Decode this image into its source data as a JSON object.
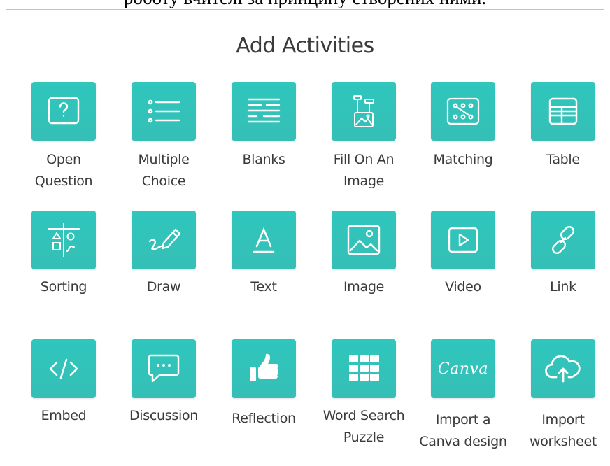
{
  "banner_text": "роботу вчителі за принципу створених ними.",
  "title": "Add Activities",
  "activities": [
    {
      "label": "Open Question",
      "icon": "question-icon"
    },
    {
      "label": "Multiple Choice",
      "icon": "list-icon"
    },
    {
      "label": "Blanks",
      "icon": "blanks-icon"
    },
    {
      "label": "Fill On An Image",
      "icon": "fill-image-icon"
    },
    {
      "label": "Matching",
      "icon": "matching-icon"
    },
    {
      "label": "Table",
      "icon": "table-icon"
    },
    {
      "label": "Sorting",
      "icon": "sorting-icon"
    },
    {
      "label": "Draw",
      "icon": "pencil-icon"
    },
    {
      "label": "Text",
      "icon": "text-icon"
    },
    {
      "label": "Image",
      "icon": "image-icon"
    },
    {
      "label": "Video",
      "icon": "video-icon"
    },
    {
      "label": "Link",
      "icon": "link-icon"
    },
    {
      "label": "Embed",
      "icon": "code-icon"
    },
    {
      "label": "Discussion",
      "icon": "chat-icon"
    },
    {
      "label": "Reflection",
      "icon": "thumbs-up-icon"
    },
    {
      "label": "Word Search Puzzle",
      "icon": "grid-icon"
    },
    {
      "label": "Import a Canva design",
      "icon": "canva-logo-icon",
      "logo_text": "Canva"
    },
    {
      "label": "Import worksheet",
      "icon": "cloud-upload-icon"
    }
  ],
  "colors": {
    "tile": "#35c3ba",
    "label": "#3a3a3a",
    "title": "#3b3b3b",
    "panel_border": "#c9c3aa"
  }
}
